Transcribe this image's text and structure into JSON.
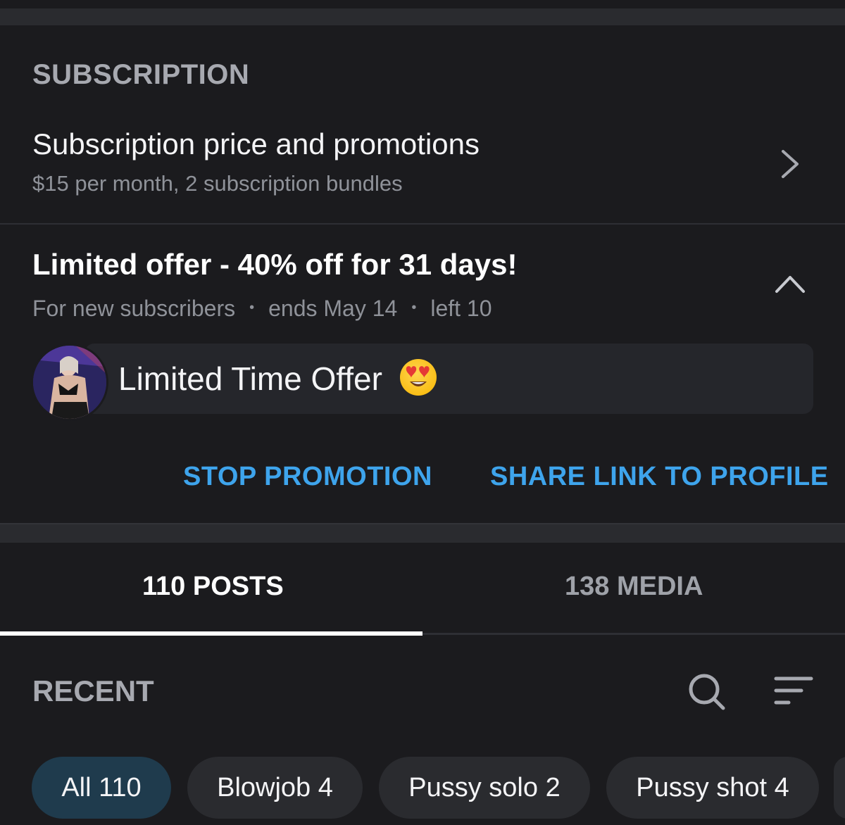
{
  "section": {
    "title": "SUBSCRIPTION"
  },
  "subscription_row": {
    "title": "Subscription price and promotions",
    "subtitle": "$15 per month, 2 subscription bundles",
    "icon": "chevron-right-icon"
  },
  "offer": {
    "title": "Limited offer - 40% off for 31 days!",
    "audience": "For new subscribers",
    "ends": "ends May 14",
    "left": "left 10",
    "separator": "•",
    "icon": "chevron-up-icon",
    "message": "Limited Time Offer",
    "emoji": "heart-eyes-emoji"
  },
  "actions": {
    "stop": "STOP PROMOTION",
    "share": "SHARE LINK TO PROFILE"
  },
  "tabs": [
    {
      "label": "110 POSTS",
      "active": true
    },
    {
      "label": "138 MEDIA",
      "active": false
    }
  ],
  "recent": {
    "title": "RECENT",
    "search_icon": "search-icon",
    "sort_icon": "sort-icon"
  },
  "filters": [
    {
      "label": "All 110",
      "active": true
    },
    {
      "label": "Blowjob 4",
      "active": false
    },
    {
      "label": "Pussy solo 2",
      "active": false
    },
    {
      "label": "Pussy shot 4",
      "active": false
    }
  ],
  "colors": {
    "background": "#1b1b1e",
    "accent": "#3ea4ec",
    "active_chip": "#1f3b4d",
    "muted_text": "#8f9299"
  }
}
